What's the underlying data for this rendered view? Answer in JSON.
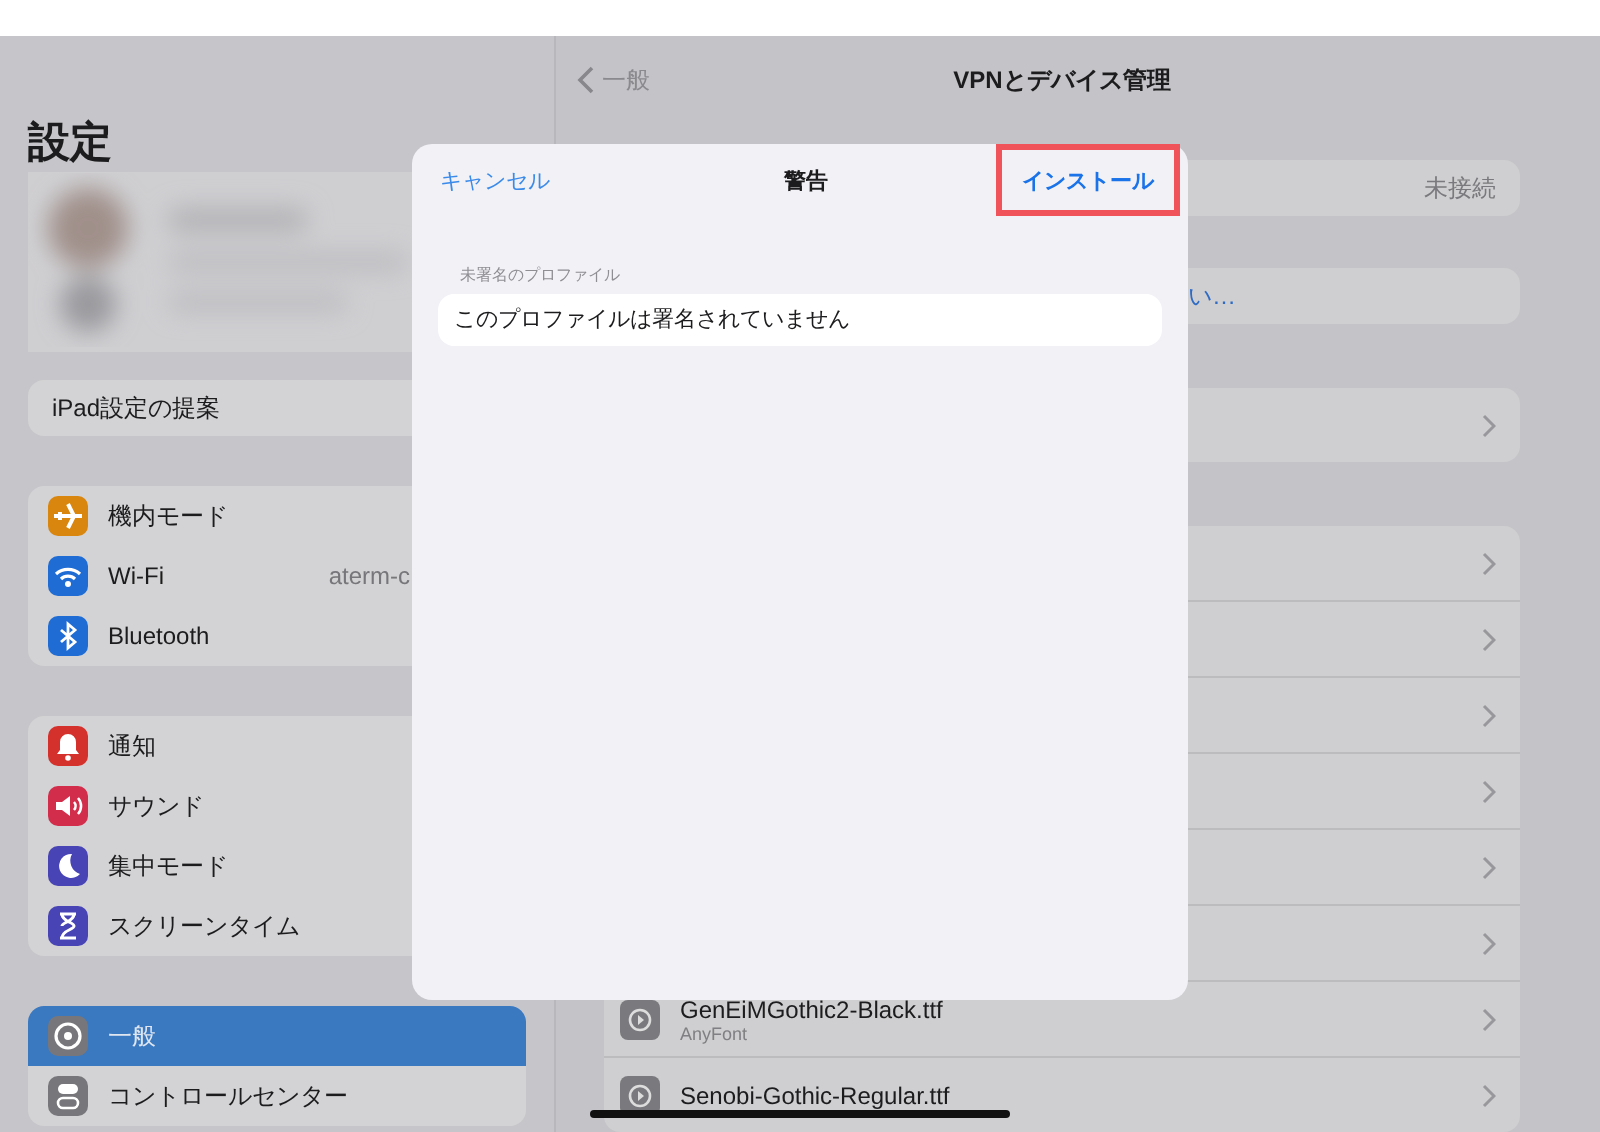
{
  "sidebar": {
    "title": "設定",
    "suggestion": "iPad設定の提案",
    "groups": [
      {
        "items": [
          {
            "label": "機内モード",
            "color": "#d9860f",
            "selected": false
          },
          {
            "label": "Wi-Fi",
            "value": "aterm-c",
            "color": "#1e6cd4",
            "selected": false
          },
          {
            "label": "Bluetooth",
            "color": "#1e6cd4",
            "selected": false
          }
        ]
      },
      {
        "items": [
          {
            "label": "通知",
            "color": "#d5312c",
            "selected": false
          },
          {
            "label": "サウンド",
            "color": "#d22d4b",
            "selected": false
          },
          {
            "label": "集中モード",
            "color": "#4844b5",
            "selected": false
          },
          {
            "label": "スクリーンタイム",
            "color": "#4844b5",
            "selected": false
          }
        ]
      },
      {
        "items": [
          {
            "label": "一般",
            "color": "#77777b",
            "selected": true
          },
          {
            "label": "コントロールセンター",
            "color": "#77777b",
            "selected": false
          }
        ]
      }
    ]
  },
  "detail": {
    "back": "一般",
    "title": "VPNとデバイス管理",
    "vpn_status": "未接続",
    "link": "い…",
    "groups": [
      {
        "rows": [
          {
            "kind": "blank"
          }
        ]
      },
      {
        "rows": [
          {
            "kind": "blank"
          },
          {
            "kind": "blank"
          },
          {
            "kind": "blank"
          },
          {
            "kind": "blank"
          },
          {
            "kind": "blank"
          },
          {
            "kind": "blank"
          },
          {
            "kind": "profile",
            "name": "GenEiMGothic2-Black.ttf",
            "source": "AnyFont"
          },
          {
            "kind": "profile",
            "name": "Senobi-Gothic-Regular.ttf"
          }
        ]
      }
    ]
  },
  "dialog": {
    "cancel": "キャンセル",
    "title": "警告",
    "install": "インストール",
    "install_highlighted": true,
    "section_label": "未署名のプロファイル",
    "message": "このプロファイルは署名されていません"
  }
}
